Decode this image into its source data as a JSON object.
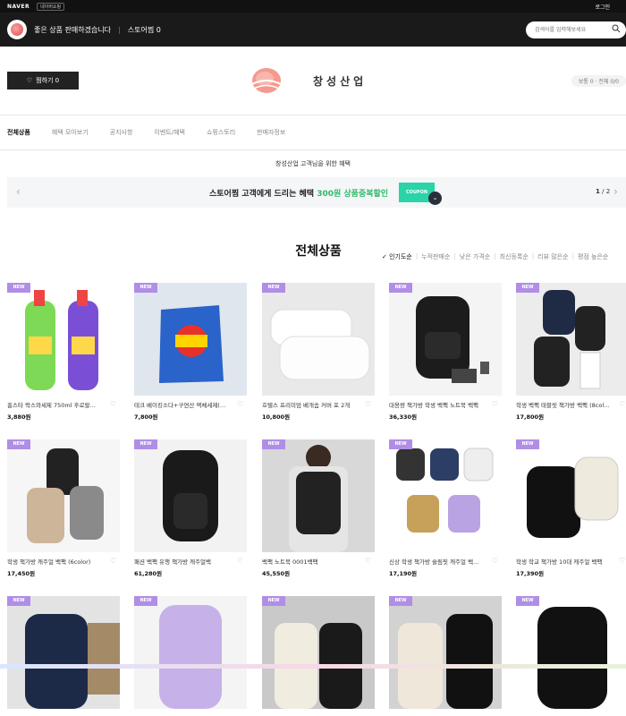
{
  "topbar": {
    "brand": "NAVER",
    "sub": "네이버쇼핑",
    "login": "로그인",
    "apps_icon": "grid-icon"
  },
  "store": {
    "message": "좋은 상품 판매하겠습니다",
    "store_level": "스토어찜 0",
    "search_placeholder": "검색어를 입력해보세요"
  },
  "header": {
    "follow_label": "찜하기 0",
    "brand_name": "창성산업",
    "level_text": "보통 0 · 전체 0/0"
  },
  "nav": {
    "items": [
      "전체상품",
      "혜택 모아보기",
      "공지사항",
      "이벤트/혜택",
      "쇼핑스토리",
      "판매자정보"
    ]
  },
  "benefit": {
    "title": "창성산업 고객님을 위한 혜택",
    "text_prefix": "스토어찜 고객에게 드리는 혜택",
    "text_highlight": "300원 상품중복할인",
    "coupon": "COUPON",
    "page_cur": "1",
    "page_total": "/ 2"
  },
  "section": {
    "title": "전체상품",
    "sorts": [
      "✓ 인기도순",
      "누적판매순",
      "낮은 가격순",
      "최신등록순",
      "리뷰 많은순",
      "평점 높은순"
    ]
  },
  "products": [
    {
      "badge": "NEW",
      "name": "홈스타 락스와세제 750ml 후로랄…",
      "price": "3,880원"
    },
    {
      "badge": "NEW",
      "name": "테크 베이킹소다+구연산 액체세제(…",
      "price": "7,800원"
    },
    {
      "badge": "NEW",
      "name": "호텔스 프리미엄 베개솜 커버 포 2개",
      "price": "10,800원"
    },
    {
      "badge": "NEW",
      "name": "대용량 책가방 학생 백팩 노트북 백팩",
      "price": "36,330원"
    },
    {
      "badge": "NEW",
      "name": "학생 백팩 태블릿 책가방 백팩 (8col…",
      "price": "17,800원"
    },
    {
      "badge": "NEW",
      "name": "학생 책가방 캐주얼 백팩 (6color)",
      "price": "17,450원"
    },
    {
      "badge": "NEW",
      "name": "패션 백팩 유행 책가방 캐주얼백",
      "price": "61,280원"
    },
    {
      "badge": "NEW",
      "name": "백팩 노트북 0001백팩",
      "price": "45,550원"
    },
    {
      "badge": "NEW",
      "name": "신상 학생 책가방 슬림핏 캐주얼 백…",
      "price": "17,190원"
    },
    {
      "badge": "NEW",
      "name": "학생 학교 책가방 10대 캐주얼 백팩",
      "price": "17,390원"
    },
    {
      "badge": "NEW",
      "name": "",
      "price": ""
    },
    {
      "badge": "NEW",
      "name": "",
      "price": ""
    },
    {
      "badge": "NEW",
      "name": "",
      "price": ""
    },
    {
      "badge": "NEW",
      "name": "",
      "price": ""
    },
    {
      "badge": "NEW",
      "name": "",
      "price": ""
    }
  ],
  "colors": {
    "accent_green": "#2fb96b",
    "badge_purple": "#b08ee6",
    "coupon_teal": "#2bd3a8",
    "topbar": "#111111"
  }
}
